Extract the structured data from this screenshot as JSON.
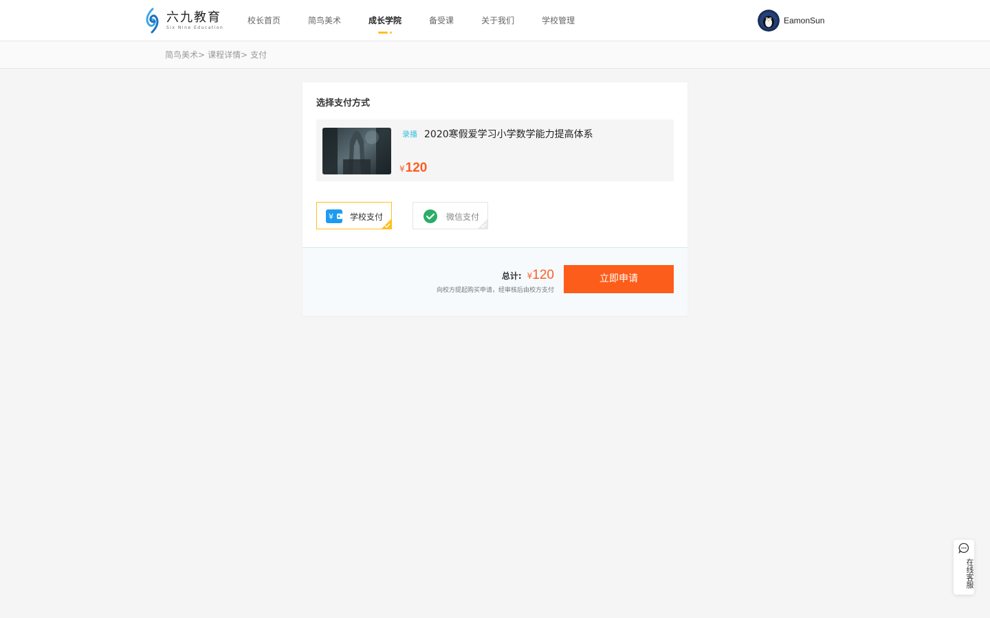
{
  "brand": {
    "name_cn": "六九教育",
    "name_en": "Six Nine Education",
    "logo_colors": [
      "#3aa7e3",
      "#1e6fbf"
    ]
  },
  "nav": {
    "items": [
      {
        "label": "校长首页",
        "active": false
      },
      {
        "label": "简鸟美术",
        "active": false
      },
      {
        "label": "成长学院",
        "active": true
      },
      {
        "label": "备受课",
        "active": false
      },
      {
        "label": "关于我们",
        "active": false
      },
      {
        "label": "学校管理",
        "active": false
      }
    ],
    "active_color": "#ffc01e"
  },
  "user": {
    "name": "EamonSun",
    "avatar_icon": "penguin-avatar-icon"
  },
  "breadcrumb": {
    "items": [
      "简鸟美术",
      "课程详情",
      "支付"
    ],
    "separator": ">"
  },
  "payment": {
    "title": "选择支付方式",
    "course": {
      "tag": "录播",
      "name": "2020寒假爱学习小学数学能力提高体系",
      "currency": "¥",
      "price": "120"
    },
    "options": [
      {
        "label": "学校支付",
        "icon": "school-wallet-icon",
        "selected": true
      },
      {
        "label": "微信支付",
        "icon": "wechat-pay-icon",
        "selected": false
      }
    ],
    "total": {
      "label": "总计:",
      "currency": "¥",
      "amount": "120",
      "note": "向校方提起购买申请，经审核后由校方支付"
    },
    "apply_button": "立即申请"
  },
  "colors": {
    "accent_orange": "#fd5d1a",
    "price_orange": "#fd5d24",
    "tag_cyan": "#35c0d9",
    "selected_border": "#ffc01e"
  },
  "service": {
    "label": "在线客服"
  }
}
